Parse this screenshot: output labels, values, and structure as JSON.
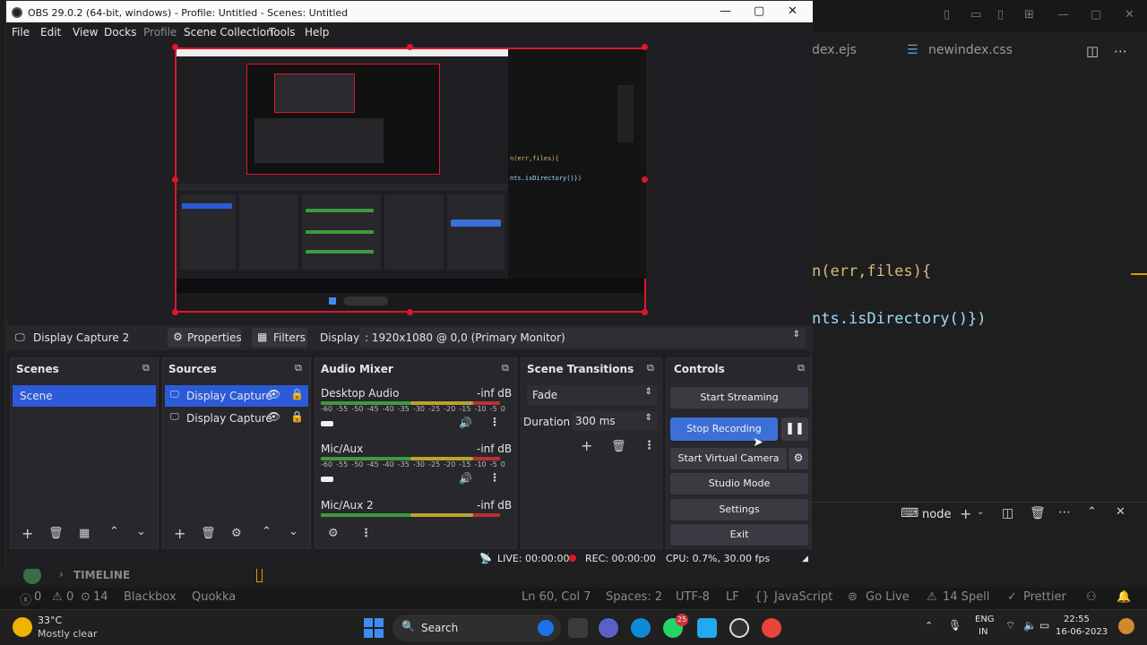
{
  "obs": {
    "title": "OBS 29.0.2 (64-bit, windows) - Profile: Untitled - Scenes: Untitled",
    "menu": [
      "File",
      "Edit",
      "View",
      "Docks",
      "Profile",
      "Scene Collection",
      "Tools",
      "Help"
    ],
    "source_bar": {
      "source_name": "Display Capture 2",
      "properties": "Properties",
      "filters": "Filters",
      "display_label": "Display",
      "display_value": ": 1920x1080 @ 0,0 (Primary Monitor)"
    },
    "scenes": {
      "header": "Scenes",
      "items": [
        "Scene"
      ]
    },
    "sources": {
      "header": "Sources",
      "items": [
        "Display Capture",
        "Display Capture"
      ]
    },
    "audio_mixer": {
      "header": "Audio Mixer",
      "ticks": [
        "-60",
        "-55",
        "-50",
        "-45",
        "-40",
        "-35",
        "-30",
        "-25",
        "-20",
        "-15",
        "-10",
        "-5",
        "0"
      ],
      "channels": [
        {
          "name": "Desktop Audio",
          "level": "-inf dB"
        },
        {
          "name": "Mic/Aux",
          "level": "-inf dB"
        },
        {
          "name": "Mic/Aux 2",
          "level": "-inf dB"
        }
      ]
    },
    "transitions": {
      "header": "Scene Transitions",
      "type": "Fade",
      "duration_label": "Duration",
      "duration_value": "300 ms"
    },
    "controls": {
      "header": "Controls",
      "start_streaming": "Start Streaming",
      "stop_recording": "Stop Recording",
      "start_virtual_camera": "Start Virtual Camera",
      "studio_mode": "Studio Mode",
      "settings": "Settings",
      "exit": "Exit"
    },
    "status": {
      "live": "LIVE: 00:00:00",
      "rec": "REC: 00:00:00",
      "cpu": "CPU: 0.7%, 30.00 fps"
    }
  },
  "vscode": {
    "tabs": [
      "dex.ejs",
      "newindex.css"
    ],
    "code_lines": [
      "n(err,files){",
      "nts.isDirectory()})"
    ],
    "terminal_name": "node",
    "timeline_label": "TIMELINE",
    "status": {
      "errors": "0",
      "warnings": "0",
      "ports": "14",
      "blackbox": "Blackbox",
      "quokka": "Quokka",
      "position": "Ln 60, Col 7",
      "spaces": "Spaces: 2",
      "encoding": "UTF-8",
      "eol": "LF",
      "language": "JavaScript",
      "golive": "Go Live",
      "spell": "14 Spell",
      "prettier": "Prettier"
    }
  },
  "taskbar": {
    "weather_temp": "33°C",
    "weather_desc": "Mostly clear",
    "search": "Search",
    "lang": "ENG",
    "region": "IN",
    "time": "22:55",
    "date": "16-06-2023",
    "notification_badge": "25"
  },
  "colors": {
    "accent": "#3c6fd8",
    "rec_red": "#e0152a",
    "selected": "#2c5bd8"
  }
}
